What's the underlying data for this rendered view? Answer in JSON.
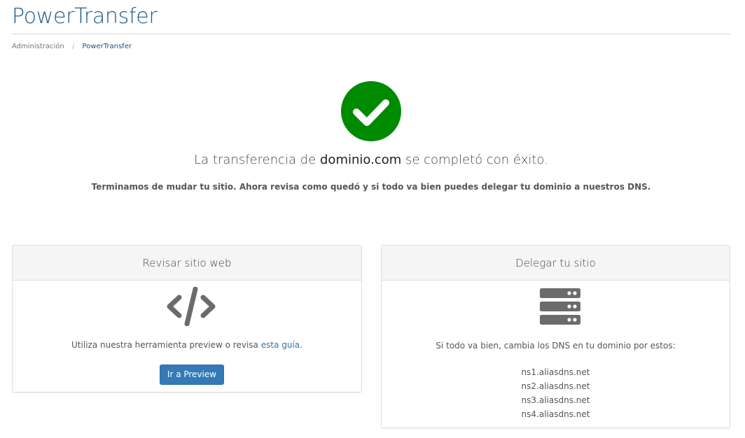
{
  "page": {
    "title": "PowerTransfer"
  },
  "breadcrumb": {
    "items": [
      "Administración",
      "PowerTransfer"
    ],
    "separator": "/"
  },
  "status": {
    "icon": "check-circle-icon",
    "color": "#008a00",
    "headline_prefix": "La transferencia de",
    "domain": "dominio.com",
    "headline_suffix": "se completó con éxito.",
    "subtext": "Terminamos de mudar tu sitio. Ahora revisa como quedó y si todo va bien puedes delegar tu dominio a nuestros DNS."
  },
  "review_card": {
    "title": "Revisar sitio web",
    "icon": "code-icon",
    "text_prefix": "Utiliza nuestra herramienta preview o revisa",
    "link_label": "esta guía",
    "text_suffix": ".",
    "button_label": "Ir a Preview",
    "button_color": "#337ab7"
  },
  "delegate_card": {
    "title": "Delegar tu sitio",
    "icon": "server-icon",
    "text": "Si todo va bien, cambia los DNS en tu dominio por estos:",
    "dns_servers": [
      "ns1.aliasdns.net",
      "ns2.aliasdns.net",
      "ns3.aliasdns.net",
      "ns4.aliasdns.net"
    ]
  },
  "colors": {
    "brand": "#1f5a8a",
    "link": "#2a7ab0",
    "icon_gray": "#6b6b6b"
  }
}
